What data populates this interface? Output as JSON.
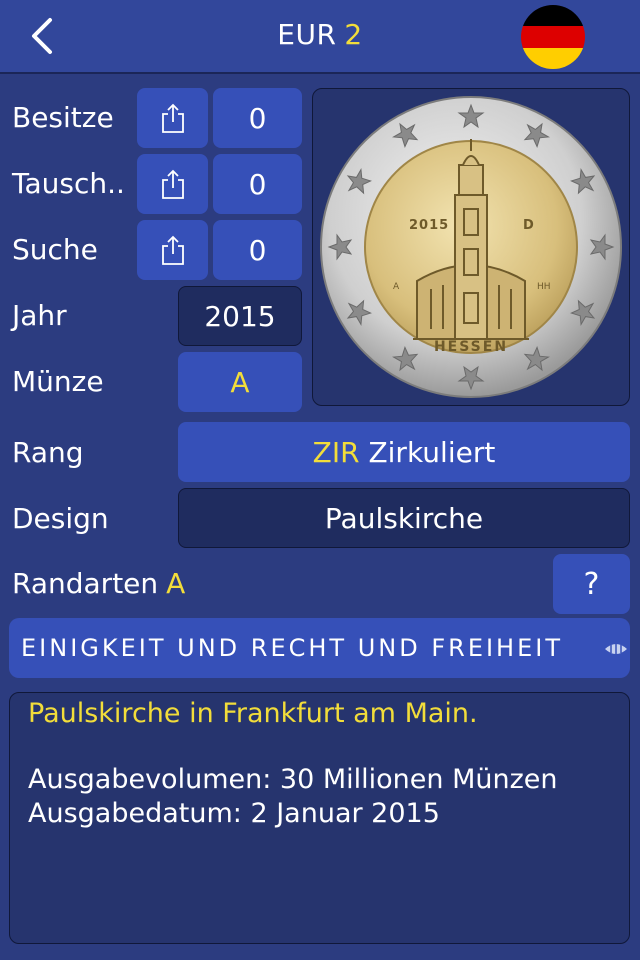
{
  "header": {
    "back_icon": "chevron-left-icon",
    "currency": "EUR",
    "denomination": "2",
    "flag": "germany-flag",
    "flag_colors": [
      "#000000",
      "#dd0000",
      "#ffce00"
    ]
  },
  "rows": {
    "besitze": {
      "label": "Besitze",
      "icon": "share-icon",
      "count": "0"
    },
    "tausch": {
      "label": "Tausch..",
      "icon": "share-icon",
      "count": "0"
    },
    "suche": {
      "label": "Suche",
      "icon": "share-icon",
      "count": "0"
    }
  },
  "jahr": {
    "label": "Jahr",
    "value": "2015"
  },
  "muenze": {
    "label": "Münze",
    "value": "A"
  },
  "rang": {
    "label": "Rang",
    "code": "ZIR",
    "text": "Zirkuliert"
  },
  "design": {
    "label": "Design",
    "value": "Paulskirche"
  },
  "randarten": {
    "label": "Randarten",
    "value": "A",
    "help": "?"
  },
  "motto": {
    "text": "EINIGKEIT UND RECHT UND FREIHEIT",
    "icon": "edge-lettering-icon"
  },
  "coin": {
    "year": "2015",
    "mint": "D",
    "left_mark": "A",
    "right_mark": "HH",
    "name": "HESSEN"
  },
  "description": {
    "line1": "Paulskirche in Frankfurt am Main.",
    "line2": "Ausgabevolumen: 30 Millionen Münzen",
    "line3": "Ausgabedatum: 2 Januar 2015"
  },
  "colors": {
    "background": "#2c3c80",
    "button": "#3650b8",
    "dark_field": "#1f2c5f",
    "accent_yellow": "#f2dd3a"
  }
}
